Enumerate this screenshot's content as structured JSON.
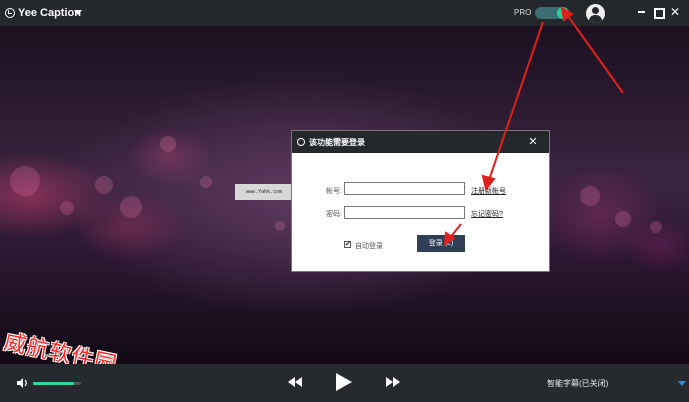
{
  "titlebar": {
    "app_title": "Yee Caption",
    "pro_label": "PRO",
    "pro_toggle_state": "on",
    "close_glyph": "✕"
  },
  "video": {
    "watermark_url": "www.Yahk.com",
    "watermark_cn": "威航软件园"
  },
  "dialog": {
    "title": "该功能需要登录",
    "close_glyph": "✕",
    "account_label": "帐号:",
    "account_value": "",
    "password_label": "密码:",
    "password_value": "",
    "register_link": "注册新帐号",
    "forgot_link": "忘记密码?",
    "auto_login_label": "自动登录",
    "auto_login_checked": "✔",
    "login_button": "登录 (L)"
  },
  "controls": {
    "volume_level": 0.85,
    "subtitle_status": "智能字幕(已关闭)"
  },
  "colors": {
    "accent": "#2dd89a",
    "annotation_arrow": "#e0201c",
    "titlebar_bg": "#24282c",
    "login_button_bg": "#2f3f55"
  },
  "icons": [
    "logo-icon",
    "chevron-down-icon",
    "user-avatar-icon",
    "minimize-icon",
    "maximize-icon",
    "close-icon",
    "volume-icon",
    "previous-icon",
    "play-icon",
    "next-icon",
    "checkbox-icon"
  ]
}
